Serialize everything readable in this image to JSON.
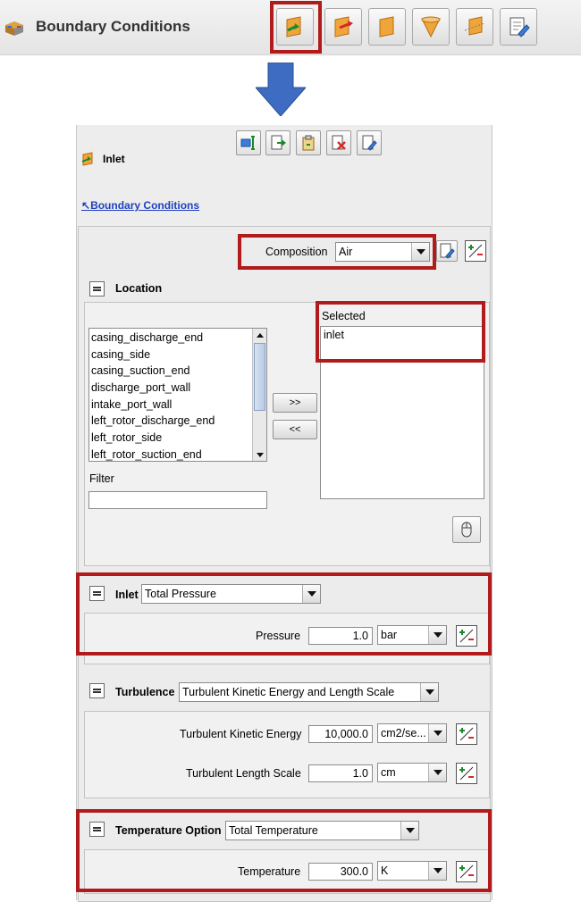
{
  "header": {
    "title": "Boundary Conditions",
    "toolbar_icons": [
      "inlet-icon",
      "outlet-icon",
      "wall-icon",
      "opening-icon",
      "symmetry-icon",
      "edit-icon"
    ]
  },
  "panel": {
    "title": "Inlet",
    "back_link": "Boundary Conditions",
    "toolbar_icons": [
      "monitor-icon",
      "export-icon",
      "paste-icon",
      "delete-icon",
      "edit-icon"
    ],
    "composition": {
      "label": "Composition",
      "value": "Air"
    },
    "location": {
      "label": "Location",
      "available": [
        "casing_discharge_end",
        "casing_side",
        "casing_suction_end",
        "discharge_port_wall",
        "intake_port_wall",
        "left_rotor_discharge_end",
        "left_rotor_side",
        "left_rotor_suction_end"
      ],
      "selected_label": "Selected",
      "selected": [
        "inlet"
      ],
      "add_button": ">>",
      "remove_button": "<<",
      "filter_label": "Filter",
      "filter_value": ""
    },
    "inlet": {
      "label": "Inlet",
      "option": "Total Pressure",
      "pressure_label": "Pressure",
      "pressure_value": "1.0",
      "pressure_unit": "bar"
    },
    "turbulence": {
      "label": "Turbulence",
      "option": "Turbulent Kinetic Energy and Length Scale",
      "tke_label": "Turbulent Kinetic Energy",
      "tke_value": "10,000.0",
      "tke_unit": "cm2/se...",
      "length_label": "Turbulent Length Scale",
      "length_value": "1.0",
      "length_unit": "cm"
    },
    "temperature": {
      "label": "Temperature Option",
      "option": "Total Temperature",
      "temperature_label": "Temperature",
      "temperature_value": "300.0",
      "temperature_unit": "K"
    }
  },
  "colors": {
    "highlight_red": "#b11b1b",
    "arrow_blue": "#3d6cc2",
    "link_blue": "#1f3fbf"
  }
}
